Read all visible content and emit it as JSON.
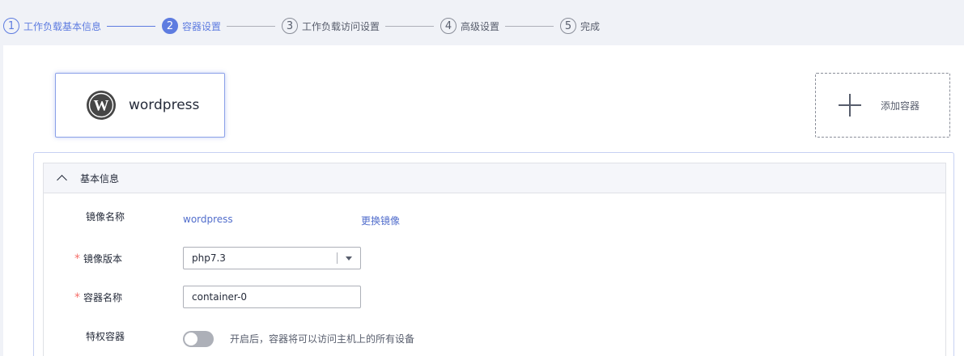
{
  "steps": [
    {
      "num": "1",
      "label": "工作负载基本信息",
      "state": "done"
    },
    {
      "num": "2",
      "label": "容器设置",
      "state": "active"
    },
    {
      "num": "3",
      "label": "工作负载访问设置",
      "state": "pending"
    },
    {
      "num": "4",
      "label": "高级设置",
      "state": "pending"
    },
    {
      "num": "5",
      "label": "完成",
      "state": "pending"
    }
  ],
  "container_card": {
    "name": "wordpress",
    "icon": "wordpress-logo-icon"
  },
  "add_container": {
    "label": "添加容器",
    "icon": "plus-icon"
  },
  "section": {
    "title": "基本信息",
    "icon": "chevron-up-icon"
  },
  "form": {
    "image_name_label": "镜像名称",
    "image_name_value": "wordpress",
    "change_image_link": "更换镜像",
    "required_mark": "*",
    "image_version_label": "镜像版本",
    "image_version_value": "php7.3",
    "container_name_label": "容器名称",
    "container_name_value": "container-0",
    "privileged_label": "特权容器",
    "privileged_hint": "开启后，容器将可以访问主机上的所有设备",
    "privileged_on": false
  },
  "colors": {
    "accent": "#5e7ce0",
    "link": "#526ecc",
    "required": "#f66f6a",
    "border": "#adb0b8"
  }
}
